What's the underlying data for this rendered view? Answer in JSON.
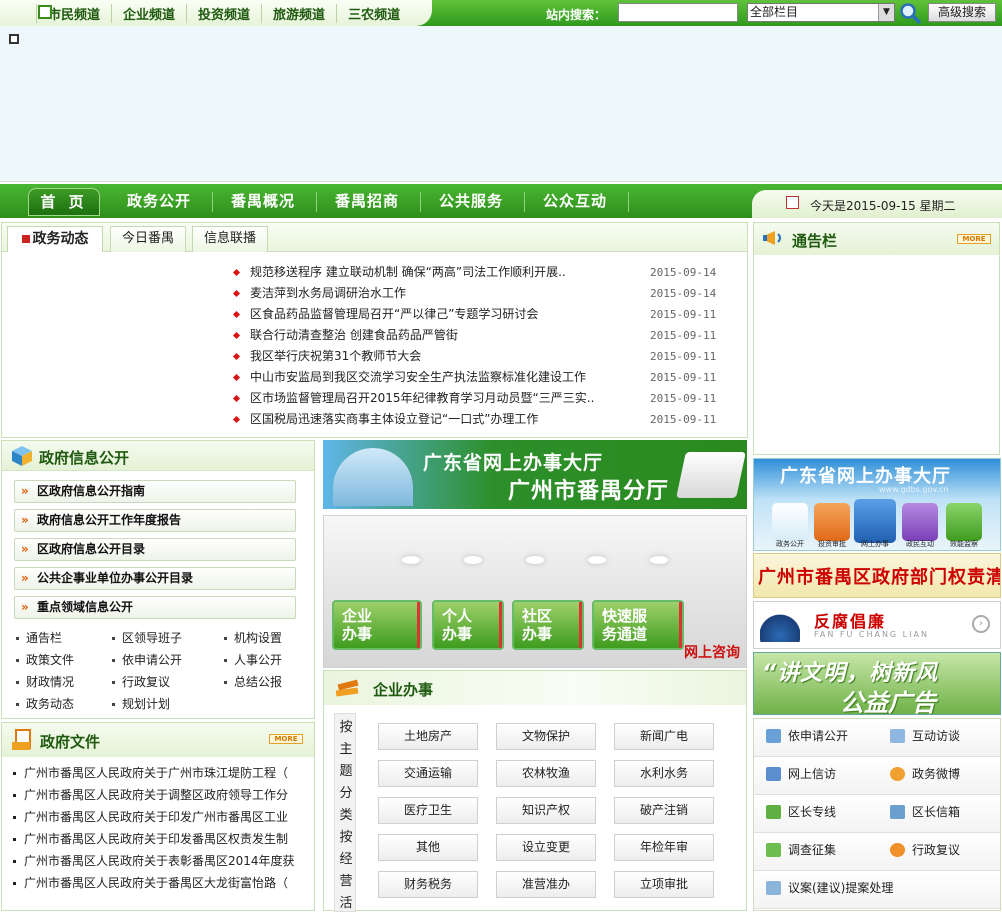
{
  "channels": [
    "市民频道",
    "企业频道",
    "投资频道",
    "旅游频道",
    "三农频道"
  ],
  "search": {
    "label": "站内搜索：",
    "scope": "全部栏目",
    "advanced": "高级搜索"
  },
  "nav": {
    "home": "首 页",
    "items": [
      "政务公开",
      "番禺概况",
      "番禺招商",
      "公共服务",
      "公众互动"
    ]
  },
  "date_text": "今天是2015-09-15 星期二",
  "news": {
    "tabs": [
      "政务动态",
      "今日番禺",
      "信息联播"
    ],
    "items": [
      {
        "title": "规范移送程序 建立联动机制 确保“两高”司法工作顺利开展..",
        "date": "2015-09-14"
      },
      {
        "title": "麦洁萍到水务局调研治水工作",
        "date": "2015-09-14"
      },
      {
        "title": "区食品药品监督管理局召开“严以律己”专题学习研讨会",
        "date": "2015-09-11"
      },
      {
        "title": "联合行动清查整治 创建食品药品严管街",
        "date": "2015-09-11"
      },
      {
        "title": "我区举行庆祝第31个教师节大会",
        "date": "2015-09-11"
      },
      {
        "title": "中山市安监局到我区交流学习安全生产执法监察标准化建设工作",
        "date": "2015-09-11"
      },
      {
        "title": "区市场监督管理局召开2015年纪律教育学习月动员暨“三严三实..",
        "date": "2015-09-11"
      },
      {
        "title": "区国税局迅速落实商事主体设立登记“一口式”办理工作",
        "date": "2015-09-11"
      }
    ]
  },
  "notice": {
    "title": "通告栏",
    "more": "MORE"
  },
  "info": {
    "title": "政府信息公开",
    "buttons": [
      "区政府信息公开指南",
      "政府信息公开工作年度报告",
      "区政府信息公开目录",
      "公共企事业单位办事公开目录",
      "重点领域信息公开"
    ],
    "links": [
      "通告栏",
      "区领导班子",
      "机构设置",
      "政策文件",
      "依申请公开",
      "人事公开",
      "财政情况",
      "行政复议",
      "总结公报",
      "政务动态",
      "规划计划"
    ]
  },
  "files": {
    "title": "政府文件",
    "more": "MORE",
    "items": [
      "广州市番禺区人民政府关于广州市珠江堤防工程（",
      "广州市番禺区人民政府关于调整区政府领导工作分",
      "广州市番禺区人民政府关于印发广州市番禺区工业",
      "广州市番禺区人民政府关于印发番禺区权责发生制",
      "广州市番禺区人民政府关于表彰番禺区2014年度获",
      "广州市番禺区人民政府关于番禺区大龙街富怡路（"
    ]
  },
  "gd_banner": {
    "line1": "广东省网上办事大厅",
    "line2": "广州市番禺分厅"
  },
  "hall": {
    "cards": [
      [
        "企业",
        "办事"
      ],
      [
        "个人",
        "办事"
      ],
      [
        "社区",
        "办事"
      ],
      [
        "快速服",
        "务通道"
      ]
    ],
    "consult": "网上咨询"
  },
  "enterprise": {
    "title": "企业办事",
    "side1": [
      "按",
      "主",
      "题",
      "分",
      "类"
    ],
    "side2": [
      "按",
      "经",
      "营",
      "活"
    ],
    "buttons": [
      "土地房产",
      "文物保护",
      "新闻广电",
      "交通运输",
      "农林牧渔",
      "水利水务",
      "医疗卫生",
      "知识产权",
      "破产注销",
      "其他",
      "设立变更",
      "年检年审",
      "财务税务",
      "准营准办",
      "立项审批"
    ]
  },
  "right": {
    "gd_title": "广东省网上办事大厅",
    "gd_url": "www.gdbs.gov.cn",
    "gd_icons": [
      "政务公开",
      "投资审批",
      "网上办事",
      "政民互动",
      "效能监察"
    ],
    "qzqd": "广州市番禺区政府部门权责清单",
    "ffcl": "反腐倡廉",
    "ffcl_sub": "FAN FU CHANG LIAN",
    "gygg1": "“讲文明，树新风",
    "gygg2": "公益广告",
    "services": [
      "依申请公开",
      "互动访谈",
      "网上信访",
      "政务微博",
      "区长专线",
      "区长信箱",
      "调查征集",
      "行政复议",
      "议案(建议)提案处理"
    ]
  }
}
